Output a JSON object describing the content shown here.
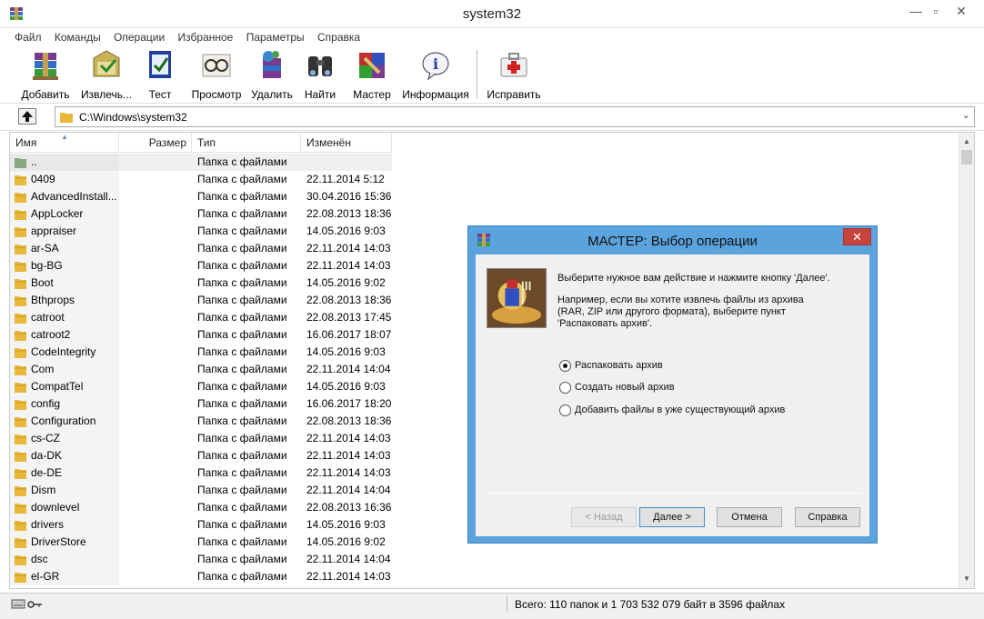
{
  "window": {
    "title": "system32"
  },
  "menu": [
    "Файл",
    "Команды",
    "Операции",
    "Избранное",
    "Параметры",
    "Справка"
  ],
  "toolbar": [
    {
      "label": "Добавить",
      "icon": "add-archive-icon"
    },
    {
      "label": "Извлечь...",
      "icon": "extract-icon"
    },
    {
      "label": "Тест",
      "icon": "test-icon"
    },
    {
      "label": "Просмотр",
      "icon": "view-icon"
    },
    {
      "label": "Удалить",
      "icon": "delete-icon"
    },
    {
      "label": "Найти",
      "icon": "find-icon"
    },
    {
      "label": "Мастер",
      "icon": "wizard-icon"
    },
    {
      "label": "Информация",
      "icon": "info-icon"
    },
    {
      "label": "Исправить",
      "icon": "repair-icon"
    }
  ],
  "address": {
    "path": "C:\\Windows\\system32"
  },
  "columns": {
    "name": "Имя",
    "size": "Размер",
    "type": "Тип",
    "modified": "Изменён"
  },
  "files": [
    {
      "name": "..",
      "type": "Папка с файлами",
      "date": ""
    },
    {
      "name": "0409",
      "type": "Папка с файлами",
      "date": "22.11.2014 5:12"
    },
    {
      "name": "AdvancedInstall...",
      "type": "Папка с файлами",
      "date": "30.04.2016 15:36"
    },
    {
      "name": "AppLocker",
      "type": "Папка с файлами",
      "date": "22.08.2013 18:36"
    },
    {
      "name": "appraiser",
      "type": "Папка с файлами",
      "date": "14.05.2016 9:03"
    },
    {
      "name": "ar-SA",
      "type": "Папка с файлами",
      "date": "22.11.2014 14:03"
    },
    {
      "name": "bg-BG",
      "type": "Папка с файлами",
      "date": "22.11.2014 14:03"
    },
    {
      "name": "Boot",
      "type": "Папка с файлами",
      "date": "14.05.2016 9:02"
    },
    {
      "name": "Bthprops",
      "type": "Папка с файлами",
      "date": "22.08.2013 18:36"
    },
    {
      "name": "catroot",
      "type": "Папка с файлами",
      "date": "22.08.2013 17:45"
    },
    {
      "name": "catroot2",
      "type": "Папка с файлами",
      "date": "16.06.2017 18:07"
    },
    {
      "name": "CodeIntegrity",
      "type": "Папка с файлами",
      "date": "14.05.2016 9:03"
    },
    {
      "name": "Com",
      "type": "Папка с файлами",
      "date": "22.11.2014 14:04"
    },
    {
      "name": "CompatTel",
      "type": "Папка с файлами",
      "date": "14.05.2016 9:03"
    },
    {
      "name": "config",
      "type": "Папка с файлами",
      "date": "16.06.2017 18:20"
    },
    {
      "name": "Configuration",
      "type": "Папка с файлами",
      "date": "22.08.2013 18:36"
    },
    {
      "name": "cs-CZ",
      "type": "Папка с файлами",
      "date": "22.11.2014 14:03"
    },
    {
      "name": "da-DK",
      "type": "Папка с файлами",
      "date": "22.11.2014 14:03"
    },
    {
      "name": "de-DE",
      "type": "Папка с файлами",
      "date": "22.11.2014 14:03"
    },
    {
      "name": "Dism",
      "type": "Папка с файлами",
      "date": "22.11.2014 14:04"
    },
    {
      "name": "downlevel",
      "type": "Папка с файлами",
      "date": "22.08.2013 16:36"
    },
    {
      "name": "drivers",
      "type": "Папка с файлами",
      "date": "14.05.2016 9:03"
    },
    {
      "name": "DriverStore",
      "type": "Папка с файлами",
      "date": "14.05.2016 9:02"
    },
    {
      "name": "dsc",
      "type": "Папка с файлами",
      "date": "22.11.2014 14:04"
    },
    {
      "name": "el-GR",
      "type": "Папка с файлами",
      "date": "22.11.2014 14:03"
    }
  ],
  "status": {
    "text": "Всего: 110 папок и 1 703 532 079 байт в 3596 файлах"
  },
  "dialog": {
    "title": "МАСТЕР:  Выбор операции",
    "intro": "Выберите нужное вам действие и нажмите кнопку 'Далее'.",
    "example_l1": "Например, если вы хотите извлечь файлы из архива",
    "example_l2": "(RAR, ZIP или другого формата), выберите пункт",
    "example_l3": "'Распаковать архив'.",
    "options": [
      {
        "label": "Распаковать архив",
        "selected": true
      },
      {
        "label": "Создать новый архив",
        "selected": false
      },
      {
        "label": "Добавить файлы в уже существующий архив",
        "selected": false
      }
    ],
    "buttons": {
      "back": "< Назад",
      "next": "Далее >",
      "cancel": "Отмена",
      "help": "Справка"
    }
  },
  "colors": {
    "dialog_frame": "#5ba3dd",
    "close_button": "#c7443c",
    "folder": "#e8b83a"
  }
}
